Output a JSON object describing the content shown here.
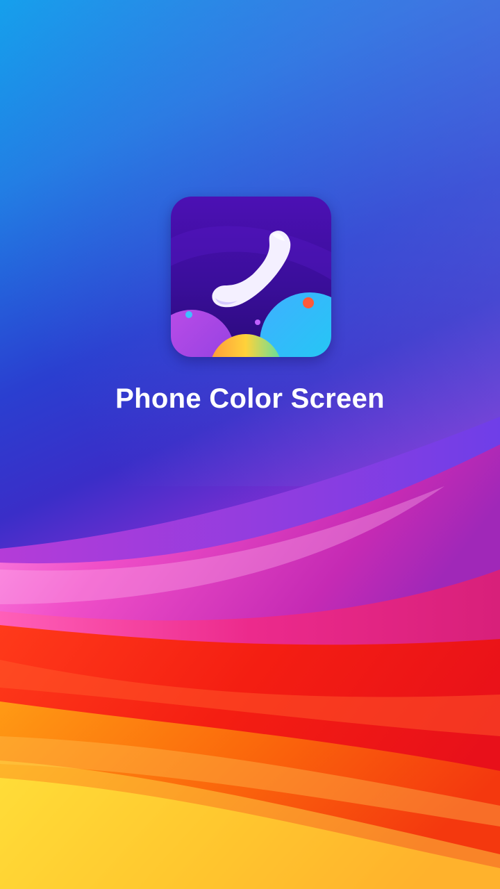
{
  "splash": {
    "app_name": "Phone Color Screen",
    "icon": "phone-handset-icon",
    "background": "colorful-waves-wallpaper"
  },
  "colors": {
    "sky_top": "#0aa8ee",
    "sky_mid": "#2a3fd0",
    "violet": "#8a2fd4",
    "magenta": "#ec2fa8",
    "red": "#f41e12",
    "orange": "#fb7a0c",
    "yellow": "#ffd22a",
    "icon_bg": "#4c10b4",
    "text": "#ffffff"
  }
}
